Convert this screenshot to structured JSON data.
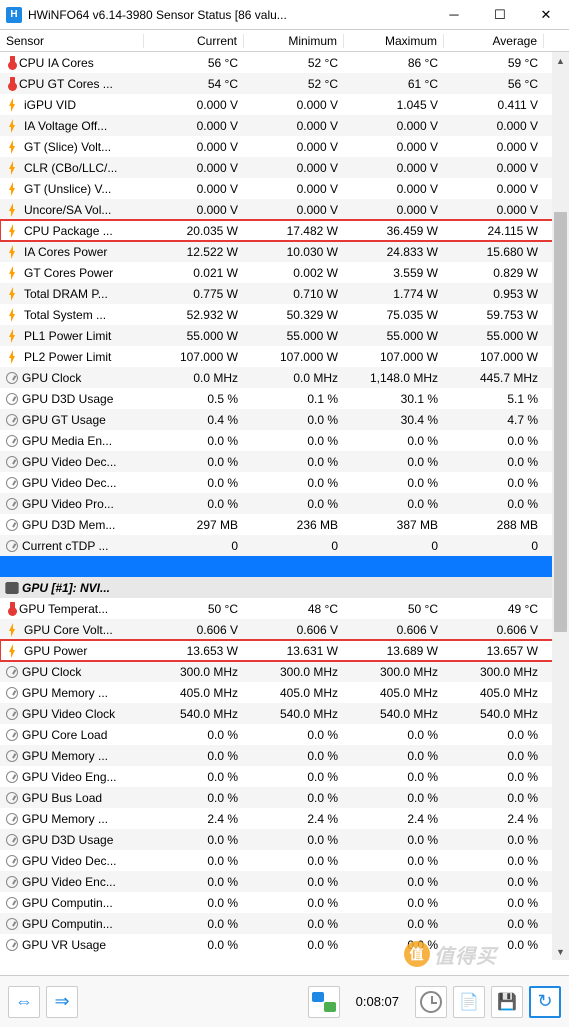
{
  "window": {
    "title": "HWiNFO64 v6.14-3980 Sensor Status [86 valu...",
    "app_icon_text": "H"
  },
  "columns": {
    "sensor": "Sensor",
    "current": "Current",
    "minimum": "Minimum",
    "maximum": "Maximum",
    "average": "Average"
  },
  "statusbar": {
    "elapsed": "0:08:07"
  },
  "sections": {
    "gpu": "GPU [#1]: NVI..."
  },
  "rows": [
    {
      "icon": "therm",
      "name": "CPU IA Cores",
      "c": "56 °C",
      "min": "52 °C",
      "max": "86 °C",
      "avg": "59 °C"
    },
    {
      "icon": "therm",
      "name": "CPU GT Cores ...",
      "c": "54 °C",
      "min": "52 °C",
      "max": "61 °C",
      "avg": "56 °C"
    },
    {
      "icon": "bolt",
      "name": "iGPU VID",
      "c": "0.000 V",
      "min": "0.000 V",
      "max": "1.045 V",
      "avg": "0.411 V"
    },
    {
      "icon": "bolt",
      "name": "IA Voltage Off...",
      "c": "0.000 V",
      "min": "0.000 V",
      "max": "0.000 V",
      "avg": "0.000 V"
    },
    {
      "icon": "bolt",
      "name": "GT (Slice) Volt...",
      "c": "0.000 V",
      "min": "0.000 V",
      "max": "0.000 V",
      "avg": "0.000 V"
    },
    {
      "icon": "bolt",
      "name": "CLR (CBo/LLC/...",
      "c": "0.000 V",
      "min": "0.000 V",
      "max": "0.000 V",
      "avg": "0.000 V"
    },
    {
      "icon": "bolt",
      "name": "GT (Unslice) V...",
      "c": "0.000 V",
      "min": "0.000 V",
      "max": "0.000 V",
      "avg": "0.000 V"
    },
    {
      "icon": "bolt",
      "name": "Uncore/SA Vol...",
      "c": "0.000 V",
      "min": "0.000 V",
      "max": "0.000 V",
      "avg": "0.000 V"
    },
    {
      "icon": "bolt",
      "name": "CPU Package ...",
      "c": "20.035 W",
      "min": "17.482 W",
      "max": "36.459 W",
      "avg": "24.115 W",
      "hl": true
    },
    {
      "icon": "bolt",
      "name": "IA Cores Power",
      "c": "12.522 W",
      "min": "10.030 W",
      "max": "24.833 W",
      "avg": "15.680 W"
    },
    {
      "icon": "bolt",
      "name": "GT Cores Power",
      "c": "0.021 W",
      "min": "0.002 W",
      "max": "3.559 W",
      "avg": "0.829 W"
    },
    {
      "icon": "bolt",
      "name": "Total DRAM P...",
      "c": "0.775 W",
      "min": "0.710 W",
      "max": "1.774 W",
      "avg": "0.953 W"
    },
    {
      "icon": "bolt",
      "name": "Total System ...",
      "c": "52.932 W",
      "min": "50.329 W",
      "max": "75.035 W",
      "avg": "59.753 W"
    },
    {
      "icon": "bolt",
      "name": "PL1 Power Limit",
      "c": "55.000 W",
      "min": "55.000 W",
      "max": "55.000 W",
      "avg": "55.000 W"
    },
    {
      "icon": "bolt",
      "name": "PL2 Power Limit",
      "c": "107.000 W",
      "min": "107.000 W",
      "max": "107.000 W",
      "avg": "107.000 W"
    },
    {
      "icon": "gauge",
      "name": "GPU Clock",
      "c": "0.0 MHz",
      "min": "0.0 MHz",
      "max": "1,148.0 MHz",
      "avg": "445.7 MHz"
    },
    {
      "icon": "gauge",
      "name": "GPU D3D Usage",
      "c": "0.5 %",
      "min": "0.1 %",
      "max": "30.1 %",
      "avg": "5.1 %"
    },
    {
      "icon": "gauge",
      "name": "GPU GT Usage",
      "c": "0.4 %",
      "min": "0.0 %",
      "max": "30.4 %",
      "avg": "4.7 %"
    },
    {
      "icon": "gauge",
      "name": "GPU Media En...",
      "c": "0.0 %",
      "min": "0.0 %",
      "max": "0.0 %",
      "avg": "0.0 %"
    },
    {
      "icon": "gauge",
      "name": "GPU Video Dec...",
      "c": "0.0 %",
      "min": "0.0 %",
      "max": "0.0 %",
      "avg": "0.0 %"
    },
    {
      "icon": "gauge",
      "name": "GPU Video Dec...",
      "c": "0.0 %",
      "min": "0.0 %",
      "max": "0.0 %",
      "avg": "0.0 %"
    },
    {
      "icon": "gauge",
      "name": "GPU Video Pro...",
      "c": "0.0 %",
      "min": "0.0 %",
      "max": "0.0 %",
      "avg": "0.0 %"
    },
    {
      "icon": "gauge",
      "name": "GPU D3D Mem...",
      "c": "297 MB",
      "min": "236 MB",
      "max": "387 MB",
      "avg": "288 MB"
    },
    {
      "icon": "gauge",
      "name": "Current cTDP ...",
      "c": "0",
      "min": "0",
      "max": "0",
      "avg": "0"
    },
    {
      "type": "blue"
    },
    {
      "type": "section",
      "icon": "chip",
      "name_key": "sections.gpu"
    },
    {
      "icon": "therm",
      "name": "GPU Temperat...",
      "c": "50 °C",
      "min": "48 °C",
      "max": "50 °C",
      "avg": "49 °C"
    },
    {
      "icon": "bolt",
      "name": "GPU Core Volt...",
      "c": "0.606 V",
      "min": "0.606 V",
      "max": "0.606 V",
      "avg": "0.606 V"
    },
    {
      "icon": "bolt",
      "name": "GPU Power",
      "c": "13.653 W",
      "min": "13.631 W",
      "max": "13.689 W",
      "avg": "13.657 W",
      "hl": true
    },
    {
      "icon": "gauge",
      "name": "GPU Clock",
      "c": "300.0 MHz",
      "min": "300.0 MHz",
      "max": "300.0 MHz",
      "avg": "300.0 MHz"
    },
    {
      "icon": "gauge",
      "name": "GPU Memory ...",
      "c": "405.0 MHz",
      "min": "405.0 MHz",
      "max": "405.0 MHz",
      "avg": "405.0 MHz"
    },
    {
      "icon": "gauge",
      "name": "GPU Video Clock",
      "c": "540.0 MHz",
      "min": "540.0 MHz",
      "max": "540.0 MHz",
      "avg": "540.0 MHz"
    },
    {
      "icon": "gauge",
      "name": "GPU Core Load",
      "c": "0.0 %",
      "min": "0.0 %",
      "max": "0.0 %",
      "avg": "0.0 %"
    },
    {
      "icon": "gauge",
      "name": "GPU Memory ...",
      "c": "0.0 %",
      "min": "0.0 %",
      "max": "0.0 %",
      "avg": "0.0 %"
    },
    {
      "icon": "gauge",
      "name": "GPU Video Eng...",
      "c": "0.0 %",
      "min": "0.0 %",
      "max": "0.0 %",
      "avg": "0.0 %"
    },
    {
      "icon": "gauge",
      "name": "GPU Bus Load",
      "c": "0.0 %",
      "min": "0.0 %",
      "max": "0.0 %",
      "avg": "0.0 %"
    },
    {
      "icon": "gauge",
      "name": "GPU Memory ...",
      "c": "2.4 %",
      "min": "2.4 %",
      "max": "2.4 %",
      "avg": "2.4 %"
    },
    {
      "icon": "gauge",
      "name": "GPU D3D Usage",
      "c": "0.0 %",
      "min": "0.0 %",
      "max": "0.0 %",
      "avg": "0.0 %"
    },
    {
      "icon": "gauge",
      "name": "GPU Video Dec...",
      "c": "0.0 %",
      "min": "0.0 %",
      "max": "0.0 %",
      "avg": "0.0 %"
    },
    {
      "icon": "gauge",
      "name": "GPU Video Enc...",
      "c": "0.0 %",
      "min": "0.0 %",
      "max": "0.0 %",
      "avg": "0.0 %"
    },
    {
      "icon": "gauge",
      "name": "GPU Computin...",
      "c": "0.0 %",
      "min": "0.0 %",
      "max": "0.0 %",
      "avg": "0.0 %"
    },
    {
      "icon": "gauge",
      "name": "GPU Computin...",
      "c": "0.0 %",
      "min": "0.0 %",
      "max": "0.0 %",
      "avg": "0.0 %"
    },
    {
      "icon": "gauge",
      "name": "GPU VR Usage",
      "c": "0.0 %",
      "min": "0.0 %",
      "max": "0.0 %",
      "avg": "0.0 %"
    }
  ]
}
